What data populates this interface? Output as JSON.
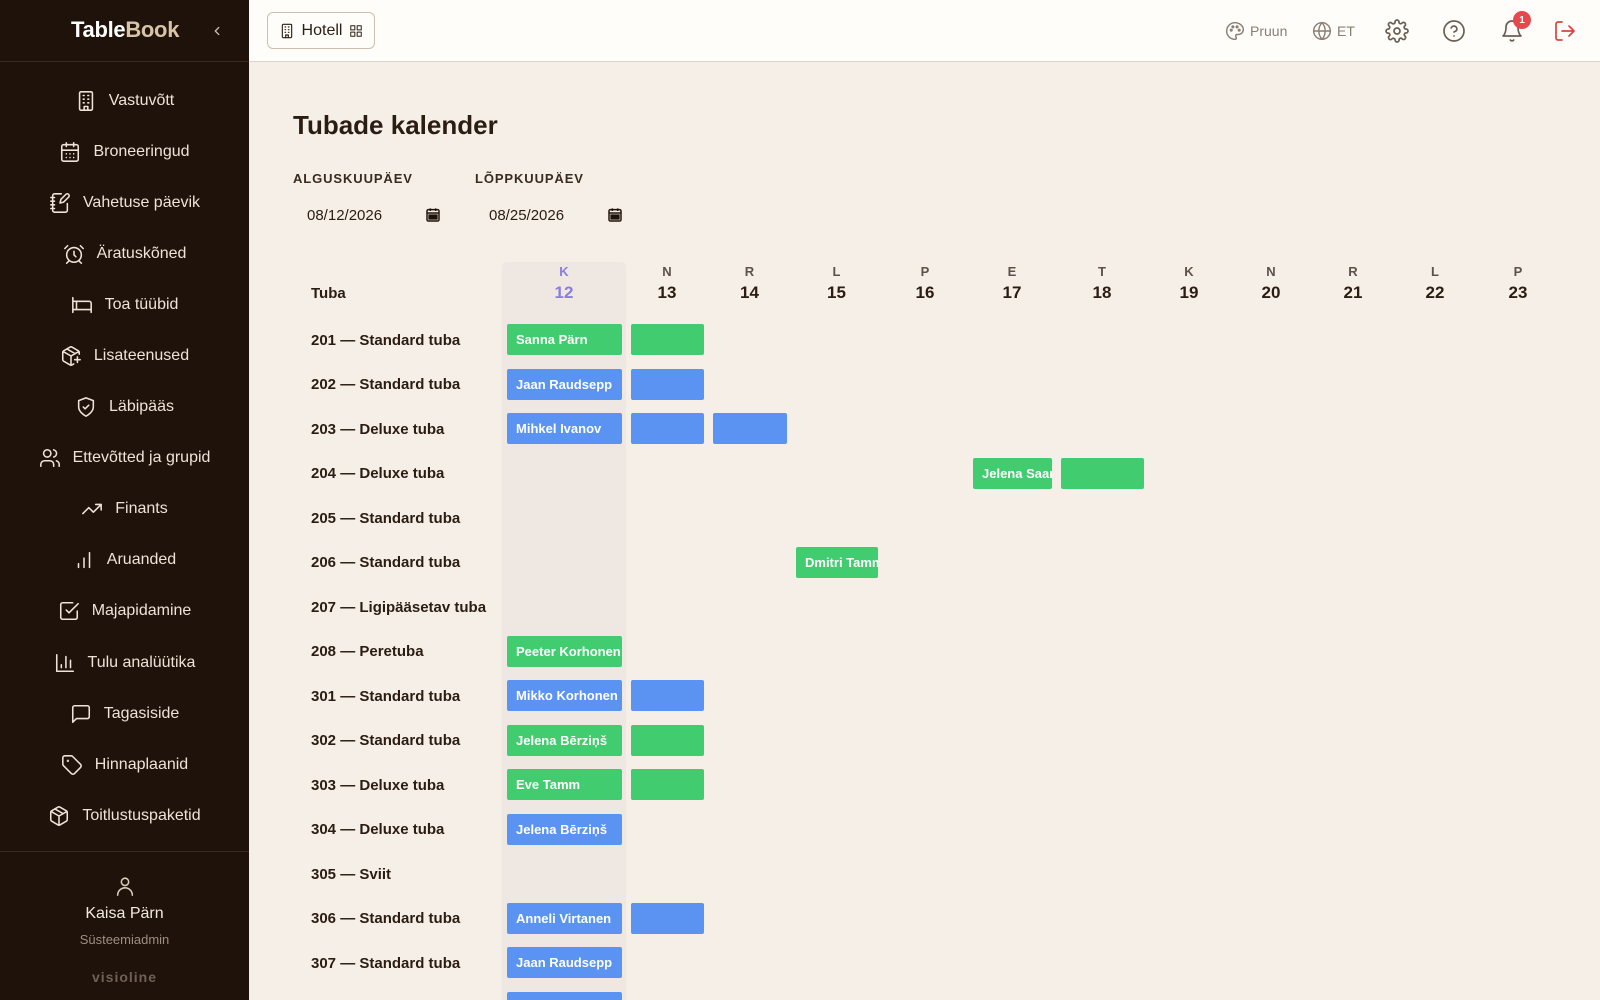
{
  "brand": {
    "part1": "Table",
    "part2": "Book"
  },
  "nav": [
    {
      "label": "Vastuvõtt",
      "icon": "building-icon"
    },
    {
      "label": "Broneeringud",
      "icon": "calendar-icon"
    },
    {
      "label": "Vahetuse päevik",
      "icon": "notebook-pen-icon"
    },
    {
      "label": "Äratuskõned",
      "icon": "alarm-clock-icon"
    },
    {
      "label": "Toa tüübid",
      "icon": "bed-icon"
    },
    {
      "label": "Lisateenused",
      "icon": "package-plus-icon"
    },
    {
      "label": "Läbipääs",
      "icon": "shield-check-icon"
    },
    {
      "label": "Ettevõtted ja grupid",
      "icon": "users-icon"
    },
    {
      "label": "Finants",
      "icon": "trending-up-icon"
    },
    {
      "label": "Aruanded",
      "icon": "bar-chart-icon"
    },
    {
      "label": "Majapidamine",
      "icon": "checkbox-icon"
    },
    {
      "label": "Tulu analüütika",
      "icon": "chart-axis-icon"
    },
    {
      "label": "Tagasiside",
      "icon": "message-icon"
    },
    {
      "label": "Hinnaplaanid",
      "icon": "tag-icon"
    },
    {
      "label": "Toitlustuspaketid",
      "icon": "box-icon"
    }
  ],
  "user": {
    "name": "Kaisa Pärn",
    "role": "Süsteemiadmin",
    "footer_brand": "visioline"
  },
  "topbar": {
    "hotel_label": "Hotell",
    "theme_label": "Pruun",
    "language_label": "ET",
    "notification_count": "1"
  },
  "page": {
    "title": "Tubade kalender",
    "start_label": "ALGUSKUUPÄEV",
    "start_value": "08/12/2026",
    "end_label": "LÕPPKUUPÄEV",
    "end_value": "08/25/2026",
    "rooms_header": "Tuba"
  },
  "days": [
    {
      "dow": "K",
      "num": "12",
      "today": true
    },
    {
      "dow": "N",
      "num": "13"
    },
    {
      "dow": "R",
      "num": "14"
    },
    {
      "dow": "L",
      "num": "15"
    },
    {
      "dow": "P",
      "num": "16"
    },
    {
      "dow": "E",
      "num": "17"
    },
    {
      "dow": "T",
      "num": "18"
    },
    {
      "dow": "K",
      "num": "19"
    },
    {
      "dow": "N",
      "num": "20"
    },
    {
      "dow": "R",
      "num": "21"
    },
    {
      "dow": "L",
      "num": "22"
    },
    {
      "dow": "P",
      "num": "23"
    }
  ],
  "rooms": [
    {
      "label": "201 — Standard tuba",
      "bookings": [
        {
          "guest": "Sanna Pärn",
          "start": 0,
          "nights": 2,
          "status": "green"
        }
      ]
    },
    {
      "label": "202 — Standard tuba",
      "bookings": [
        {
          "guest": "Jaan Raudsepp",
          "start": 0,
          "nights": 2,
          "status": "blue"
        }
      ]
    },
    {
      "label": "203 — Deluxe tuba",
      "bookings": [
        {
          "guest": "Mihkel Ivanov",
          "start": 0,
          "nights": 3,
          "status": "blue"
        }
      ]
    },
    {
      "label": "204 — Deluxe tuba",
      "bookings": [
        {
          "guest": "Jelena Saar",
          "start": 5,
          "nights": 2,
          "status": "green"
        }
      ]
    },
    {
      "label": "205 — Standard tuba",
      "bookings": []
    },
    {
      "label": "206 — Standard tuba",
      "bookings": [
        {
          "guest": "Dmitri Tamm",
          "start": 3,
          "nights": 1,
          "status": "green"
        }
      ]
    },
    {
      "label": "207 — Ligipääsetav tuba",
      "bookings": []
    },
    {
      "label": "208 — Peretuba",
      "bookings": [
        {
          "guest": "Peeter Korhonen",
          "start": 0,
          "nights": 1,
          "status": "green"
        }
      ]
    },
    {
      "label": "301 — Standard tuba",
      "bookings": [
        {
          "guest": "Mikko Korhonen",
          "start": 0,
          "nights": 2,
          "status": "blue"
        }
      ]
    },
    {
      "label": "302 — Standard tuba",
      "bookings": [
        {
          "guest": "Jelena Bērziņš",
          "start": 0,
          "nights": 2,
          "status": "green"
        }
      ]
    },
    {
      "label": "303 — Deluxe tuba",
      "bookings": [
        {
          "guest": "Eve Tamm",
          "start": 0,
          "nights": 2,
          "status": "green"
        }
      ]
    },
    {
      "label": "304 — Deluxe tuba",
      "bookings": [
        {
          "guest": "Jelena Bērziņš",
          "start": 0,
          "nights": 1,
          "status": "blue"
        }
      ]
    },
    {
      "label": "305 — Sviit",
      "bookings": []
    },
    {
      "label": "306 — Standard tuba",
      "bookings": [
        {
          "guest": "Anneli Virtanen",
          "start": 0,
          "nights": 2,
          "status": "blue"
        }
      ]
    },
    {
      "label": "307 — Standard tuba",
      "bookings": [
        {
          "guest": "Jaan Raudsepp",
          "start": 0,
          "nights": 1,
          "status": "blue"
        }
      ]
    },
    {
      "label": "",
      "bookings": [
        {
          "guest": "",
          "start": 0,
          "nights": 1,
          "status": "blue"
        }
      ]
    }
  ],
  "colors": {
    "green": "#41cc70",
    "blue": "#5b93f2",
    "today": "#8a7de0"
  }
}
